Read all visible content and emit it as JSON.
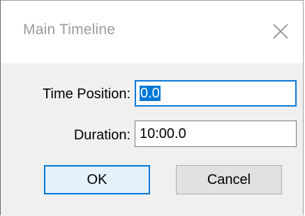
{
  "window": {
    "title": "Main Timeline",
    "close_icon": "close-icon"
  },
  "form": {
    "time_position_label": "Time Position:",
    "time_position_value": "0.0",
    "duration_label": "Duration:",
    "duration_value": "10:00.0"
  },
  "buttons": {
    "ok_label": "OK",
    "cancel_label": "Cancel"
  },
  "colors": {
    "selection": "#0078d7",
    "title_text": "#9a9a9a",
    "client_background": "#f0f0f0"
  }
}
